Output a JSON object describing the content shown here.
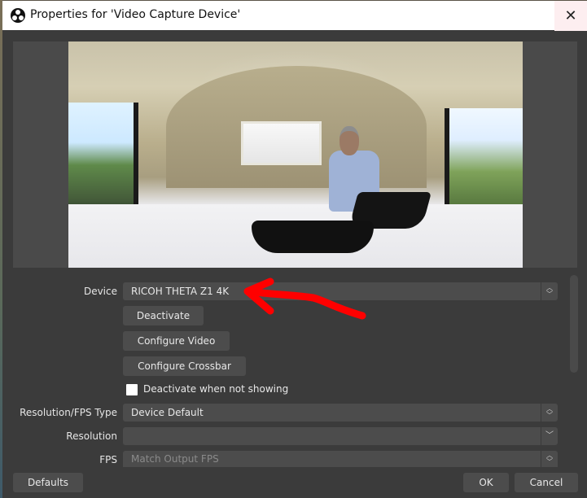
{
  "window": {
    "title": "Properties for 'Video Capture Device'",
    "app_icon": "obs-logo-icon",
    "close_icon": "close-icon"
  },
  "preview": {
    "description": "360-degree equirectangular camera preview of a home office with a person at a desk"
  },
  "annotation": {
    "arrow_color": "#ff0000",
    "points_to": "device-select"
  },
  "properties": {
    "device": {
      "label": "Device",
      "value": "RICOH THETA Z1 4K"
    },
    "buttons": {
      "deactivate": "Deactivate",
      "configure_video": "Configure Video",
      "configure_crossbar": "Configure Crossbar"
    },
    "deactivate_when_not_showing": {
      "label": "Deactivate when not showing",
      "checked": false
    },
    "resolution_fps_type": {
      "label": "Resolution/FPS Type",
      "value": "Device Default"
    },
    "resolution": {
      "label": "Resolution",
      "value": ""
    },
    "fps": {
      "label": "FPS",
      "value": "Match Output FPS"
    }
  },
  "footer": {
    "defaults": "Defaults",
    "ok": "OK",
    "cancel": "Cancel"
  }
}
